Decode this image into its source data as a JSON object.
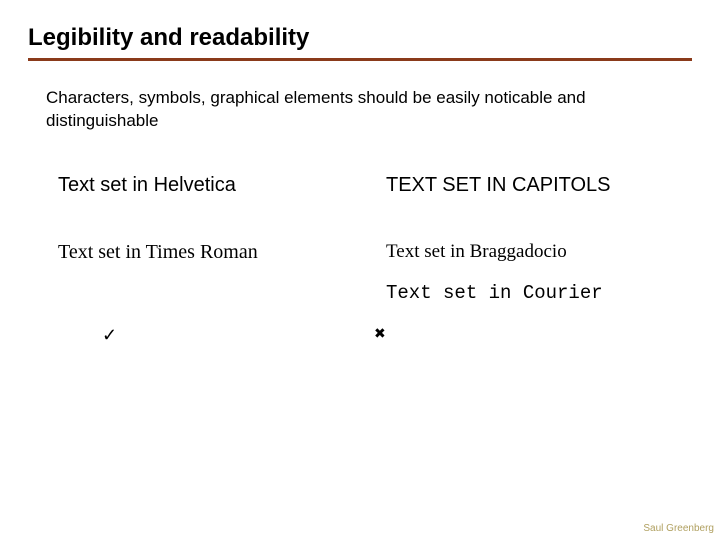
{
  "title": "Legibility and readability",
  "body": "Characters, symbols, graphical elements should be easily noticable and distinguishable",
  "samples": {
    "helvetica": "Text set in Helvetica",
    "capitols": "TEXT SET IN CAPITOLS",
    "times": "Text set in Times Roman",
    "braggadocio": "Text set in Braggadocio",
    "courier": "Text set in Courier"
  },
  "marks": {
    "check": "✓",
    "cross": "✖"
  },
  "footer": "Saul Greenberg"
}
